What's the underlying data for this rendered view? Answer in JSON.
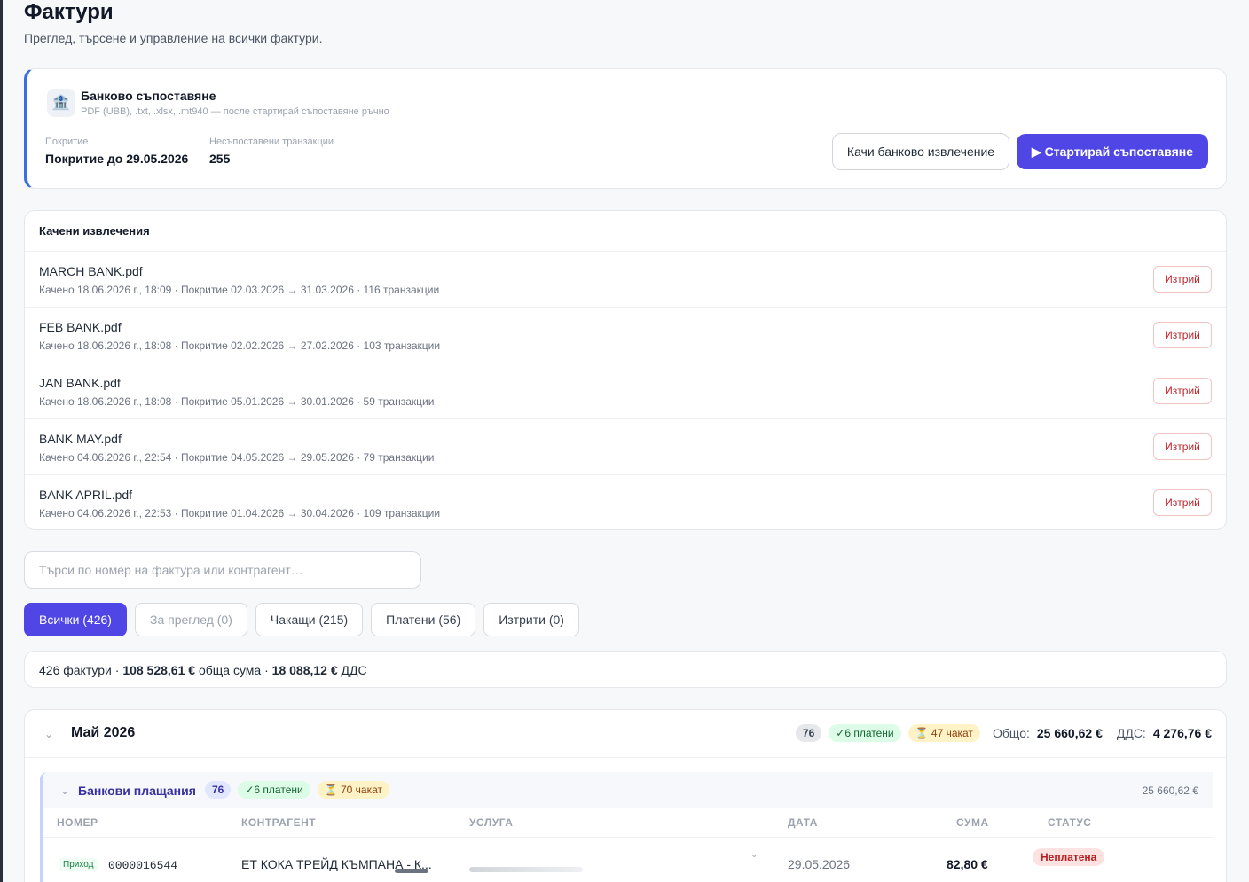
{
  "header": {
    "title": "Фактури",
    "subtitle": "Преглед, търсене и управление на всички фактури."
  },
  "bank": {
    "icon": "bank-icon",
    "title": "Банково съпоставяне",
    "formats": "PDF (UBB), .txt, .xlsx, .mt940 — после стартирай съпоставяне ръчно",
    "coverage_label": "Покритие",
    "coverage_value": "Покритие до 29.05.2026",
    "unmatched_label": "Несъпоставени транзакции",
    "unmatched_value": "255",
    "upload_button": "Качи банково извлечение",
    "start_button": "▶ Стартирай съпоставяне"
  },
  "uploads": {
    "title": "Качени извлечения",
    "delete_label": "Изтрий",
    "items": [
      {
        "name": "MARCH BANK.pdf",
        "meta": "Качено 18.06.2026 г., 18:09 · Покритие 02.03.2026 → 31.03.2026 · 116 транзакции"
      },
      {
        "name": "FEB BANK.pdf",
        "meta": "Качено 18.06.2026 г., 18:08 · Покритие 02.02.2026 → 27.02.2026 · 103 транзакции"
      },
      {
        "name": "JAN BANK.pdf",
        "meta": "Качено 18.06.2026 г., 18:08 · Покритие 05.01.2026 → 30.01.2026 · 59 транзакции"
      },
      {
        "name": "BANK MAY.pdf",
        "meta": "Качено 04.06.2026 г., 22:54 · Покритие 04.05.2026 → 29.05.2026 · 79 транзакции"
      },
      {
        "name": "BANK APRIL.pdf",
        "meta": "Качено 04.06.2026 г., 22:53 · Покритие 01.04.2026 → 30.04.2026 · 109 транзакции"
      }
    ]
  },
  "search": {
    "placeholder": "Търси по номер на фактура или контрагент…",
    "value": ""
  },
  "tabs": [
    {
      "label": "Всички (426)",
      "active": true
    },
    {
      "label": "За преглед (0)",
      "muted": true
    },
    {
      "label": "Чакащи (215)"
    },
    {
      "label": "Платени (56)"
    },
    {
      "label": "Изтрити (0)"
    }
  ],
  "summary": {
    "count": "426 фактури",
    "sep1": " · ",
    "total": "108 528,61 €",
    "total_label": " обща сума",
    "sep2": " · ",
    "vat": "18 088,12 €",
    "vat_label": " ДДС"
  },
  "month": {
    "title": "Май 2026",
    "count": "76",
    "paid": "✓6 платени",
    "waiting": "⏳ 47 чакат",
    "total_label": "Общо:",
    "total_value": "25 660,62 €",
    "vat_label": "ДДС:",
    "vat_value": "4 276,76 €"
  },
  "bank_payments": {
    "title": "Банкови плащания",
    "count": "76",
    "paid": "✓6 платени",
    "waiting": "⏳ 70 чакат",
    "total": "25 660,62 €"
  },
  "table": {
    "columns": {
      "number": "НОМЕР",
      "counterparty": "КОНТРАГЕНТ",
      "service": "УСЛУГА",
      "date": "ДАТА",
      "amount": "СУМА",
      "status": "СТАТУС"
    },
    "row": {
      "type": "Приход",
      "number": "0000016544",
      "counterparty": "ЕТ КОКА ТРЕЙД КЪМПАНА - К...",
      "date": "29.05.2026",
      "amount": "82,80 €",
      "status": "Неплатена"
    }
  }
}
